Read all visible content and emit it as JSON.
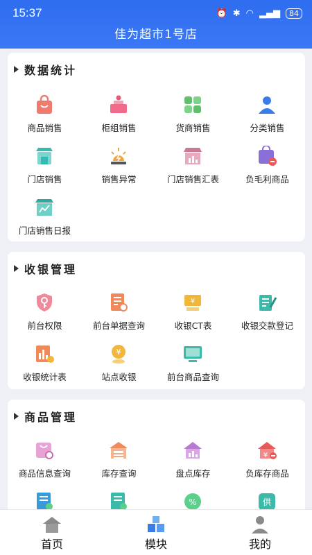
{
  "status": {
    "time": "15:37",
    "battery": "84"
  },
  "app_title": "佳为超市1号店",
  "sections": [
    {
      "title": "数据统计",
      "items": [
        {
          "label": "商品销售",
          "icon": "shopping-bag-icon"
        },
        {
          "label": "柜组销售",
          "icon": "counter-icon"
        },
        {
          "label": "货商销售",
          "icon": "grid-icon"
        },
        {
          "label": "分类销售",
          "icon": "person-icon"
        },
        {
          "label": "门店销售",
          "icon": "store-icon"
        },
        {
          "label": "销售异常",
          "icon": "alert-light-icon"
        },
        {
          "label": "门店销售汇表",
          "icon": "store-chart-icon"
        },
        {
          "label": "负毛利商品",
          "icon": "negative-bag-icon"
        },
        {
          "label": "门店销售日报",
          "icon": "store-report-icon"
        }
      ]
    },
    {
      "title": "收银管理",
      "items": [
        {
          "label": "前台权限",
          "icon": "shield-key-icon"
        },
        {
          "label": "前台单据查询",
          "icon": "document-search-icon"
        },
        {
          "label": "收银CT表",
          "icon": "cash-register-icon"
        },
        {
          "label": "收银交款登记",
          "icon": "notebook-pen-icon"
        },
        {
          "label": "收银统计表",
          "icon": "bar-chart-icon"
        },
        {
          "label": "站点收银",
          "icon": "yen-location-icon"
        },
        {
          "label": "前台商品查询",
          "icon": "monitor-icon"
        }
      ]
    },
    {
      "title": "商品管理",
      "items": [
        {
          "label": "商品信息查询",
          "icon": "bag-search-icon"
        },
        {
          "label": "库存查询",
          "icon": "warehouse-icon"
        },
        {
          "label": "盘点库存",
          "icon": "house-chart-icon"
        },
        {
          "label": "负库存商品",
          "icon": "yen-house-icon"
        },
        {
          "label": "",
          "icon": "document-check-icon"
        },
        {
          "label": "",
          "icon": "document-check-icon"
        },
        {
          "label": "",
          "icon": "percent-icon"
        },
        {
          "label": "",
          "icon": "supply-icon"
        }
      ]
    }
  ],
  "nav": [
    {
      "label": "首页",
      "icon": "home-icon"
    },
    {
      "label": "模块",
      "icon": "cubes-icon"
    },
    {
      "label": "我的",
      "icon": "user-icon"
    }
  ]
}
